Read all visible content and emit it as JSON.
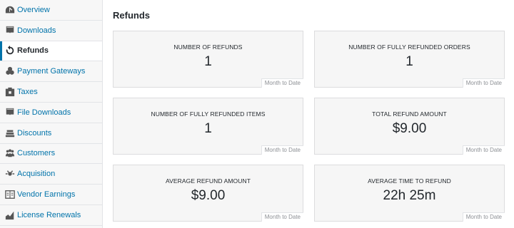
{
  "sidebar": {
    "items": [
      {
        "label": "Overview",
        "icon": "dashboard-icon"
      },
      {
        "label": "Downloads",
        "icon": "download-icon"
      },
      {
        "label": "Refunds",
        "icon": "refresh-icon",
        "active": true
      },
      {
        "label": "Payment Gateways",
        "icon": "payment-gateways-icon"
      },
      {
        "label": "Taxes",
        "icon": "taxes-icon"
      },
      {
        "label": "File Downloads",
        "icon": "file-download-icon"
      },
      {
        "label": "Discounts",
        "icon": "discounts-icon"
      },
      {
        "label": "Customers",
        "icon": "customers-icon"
      },
      {
        "label": "Acquisition",
        "icon": "acquisition-icon"
      },
      {
        "label": "Vendor Earnings",
        "icon": "vendor-earnings-icon"
      },
      {
        "label": "License Renewals",
        "icon": "license-renewals-icon"
      }
    ]
  },
  "main": {
    "title": "Refunds",
    "cards": [
      {
        "label": "NUMBER OF REFUNDS",
        "value": "1",
        "period": "Month to Date"
      },
      {
        "label": "NUMBER OF FULLY REFUNDED ORDERS",
        "value": "1",
        "period": "Month to Date"
      },
      {
        "label": "NUMBER OF FULLY REFUNDED ITEMS",
        "value": "1",
        "period": "Month to Date"
      },
      {
        "label": "TOTAL REFUND AMOUNT",
        "value": "$9.00",
        "period": "Month to Date"
      },
      {
        "label": "AVERAGE REFUND AMOUNT",
        "value": "$9.00",
        "period": "Month to Date"
      },
      {
        "label": "AVERAGE TIME TO REFUND",
        "value": "22h 25m",
        "period": "Month to Date"
      }
    ]
  },
  "colors": {
    "link": "#0073aa",
    "active_marker": "#0073aa",
    "card_bg": "#f6f6f6"
  }
}
